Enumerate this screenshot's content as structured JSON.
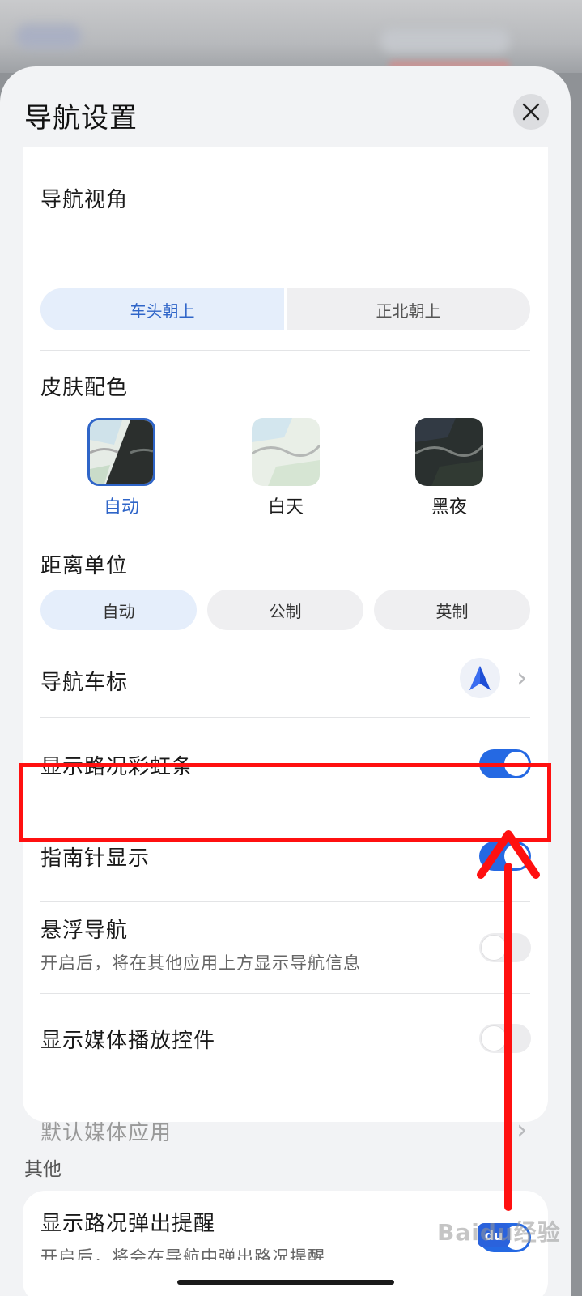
{
  "sheet": {
    "title": "导航设置"
  },
  "nav_view": {
    "title": "导航视角",
    "options": [
      "车头朝上",
      "正北朝上"
    ],
    "selected": "车头朝上"
  },
  "skin": {
    "title": "皮肤配色",
    "options": [
      "自动",
      "白天",
      "黑夜"
    ],
    "selected": "自动"
  },
  "distance_unit": {
    "title": "距离单位",
    "options": [
      "自动",
      "公制",
      "英制"
    ],
    "selected": "自动"
  },
  "car_marker": {
    "label": "导航车标"
  },
  "traffic_rainbow": {
    "label": "显示路况彩虹条",
    "enabled": true
  },
  "compass": {
    "label": "指南针显示",
    "enabled": true
  },
  "floating_nav": {
    "label": "悬浮导航",
    "sub": "开启后，将在其他应用上方显示导航信息",
    "enabled": false
  },
  "media_controls": {
    "label": "显示媒体播放控件",
    "enabled": false
  },
  "default_media_app": {
    "label": "默认媒体应用"
  },
  "other": {
    "section_label": "其他",
    "traffic_popup_label": "显示路况弹出提醒",
    "traffic_popup_sub": "开启后，将会在导航中弹出路况提醒"
  },
  "colors": {
    "accent": "#2569e3",
    "highlight": "#ff1010"
  },
  "watermark": "Baidu经验",
  "badge": "du"
}
